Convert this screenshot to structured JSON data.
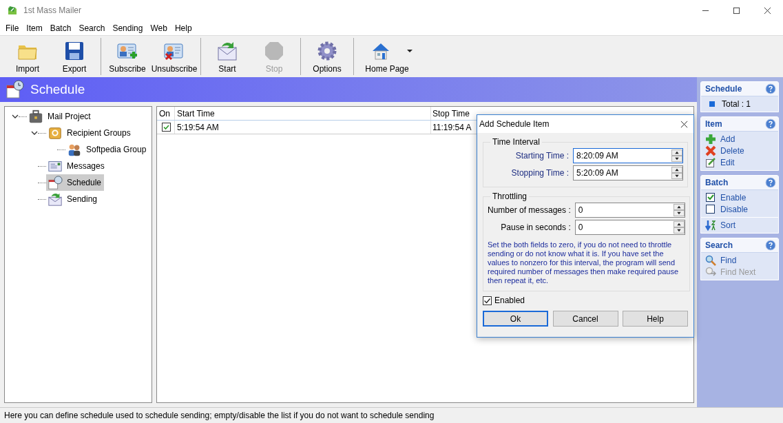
{
  "window": {
    "title": "1st Mass Mailer"
  },
  "menu": [
    "File",
    "Item",
    "Batch",
    "Search",
    "Sending",
    "Web",
    "Help"
  ],
  "toolbar": [
    [
      {
        "label": "Import",
        "kind": "folder",
        "disabled": false,
        "dropdown": false
      },
      {
        "label": "Export",
        "kind": "disk",
        "disabled": false,
        "dropdown": false
      }
    ],
    [
      {
        "label": "Subscribe",
        "kind": "subscribe",
        "disabled": false,
        "dropdown": false
      },
      {
        "label": "Unsubscribe",
        "kind": "unsubscribe",
        "disabled": false,
        "dropdown": false
      }
    ],
    [
      {
        "label": "Start",
        "kind": "start",
        "disabled": false,
        "dropdown": false
      },
      {
        "label": "Stop",
        "kind": "stop",
        "disabled": true,
        "dropdown": false
      }
    ],
    [
      {
        "label": "Options",
        "kind": "gear",
        "disabled": false,
        "dropdown": false
      }
    ],
    [
      {
        "label": "Home Page",
        "kind": "home",
        "disabled": false,
        "dropdown": true
      }
    ]
  ],
  "header": {
    "title": "Schedule"
  },
  "tree": [
    {
      "label": "Mail Project",
      "kind": "case",
      "expanded": true,
      "selected": false,
      "children": [
        {
          "label": "Recipient Groups",
          "kind": "book",
          "expanded": true,
          "selected": false,
          "children": [
            {
              "label": "Softpedia Group",
              "kind": "people",
              "selected": false
            }
          ]
        },
        {
          "label": "Messages",
          "kind": "letter",
          "selected": false
        },
        {
          "label": "Schedule",
          "kind": "calendar",
          "selected": true
        },
        {
          "label": "Sending",
          "kind": "send",
          "selected": false
        }
      ]
    }
  ],
  "table": {
    "columns": [
      "On",
      "Start Time",
      "Stop Time"
    ],
    "rows": [
      {
        "on": true,
        "start": "5:19:54 AM",
        "stop": "11:19:54 A"
      }
    ]
  },
  "dialog": {
    "title": "Add Schedule Item",
    "groups": [
      {
        "title": "Time Interval",
        "fields": [
          {
            "label": "Starting Time :",
            "value": "8:20:09 AM",
            "focused": true,
            "accent": true
          },
          {
            "label": "Stopping Time :",
            "value": "5:20:09 AM",
            "focused": false,
            "accent": true
          }
        ]
      },
      {
        "title": "Throttling",
        "fields": [
          {
            "label": "Number of messages :",
            "value": "0",
            "focused": false,
            "accent": false
          },
          {
            "label": "Pause in seconds :",
            "value": "0",
            "focused": false,
            "accent": false
          }
        ],
        "note": "Set the both fields to zero, if you do not need to throttle sending or do not know what it is. If you have set the values to nonzero for this interval, the program will send required number of messages then make required pause then repeat it, etc."
      }
    ],
    "enabled": {
      "label": "Enabled",
      "checked": true
    },
    "buttons": [
      {
        "label": "Ok",
        "default": true
      },
      {
        "label": "Cancel",
        "default": false
      },
      {
        "label": "Help",
        "default": false
      }
    ]
  },
  "tasks": [
    {
      "title": "Schedule",
      "groups": [
        [
          {
            "label": "Total : 1",
            "kind": "total",
            "disabled": false
          }
        ]
      ]
    },
    {
      "title": "Item",
      "groups": [
        [
          {
            "label": "Add",
            "kind": "add",
            "disabled": false
          },
          {
            "label": "Delete",
            "kind": "delete",
            "disabled": false
          },
          {
            "label": "Edit",
            "kind": "edit",
            "disabled": false
          }
        ]
      ]
    },
    {
      "title": "Batch",
      "groups": [
        [
          {
            "label": "Enable",
            "kind": "enable",
            "disabled": false
          },
          {
            "label": "Disable",
            "kind": "disable",
            "disabled": false
          }
        ],
        [
          {
            "label": "Sort",
            "kind": "sort",
            "disabled": false
          }
        ]
      ]
    },
    {
      "title": "Search",
      "groups": [
        [
          {
            "label": "Find",
            "kind": "find",
            "disabled": false
          },
          {
            "label": "Find Next",
            "kind": "findnext",
            "disabled": true
          }
        ]
      ]
    }
  ],
  "status_bar": "Here you can define schedule used to schedule sending; empty/disable the list if you do not want to schedule sending"
}
